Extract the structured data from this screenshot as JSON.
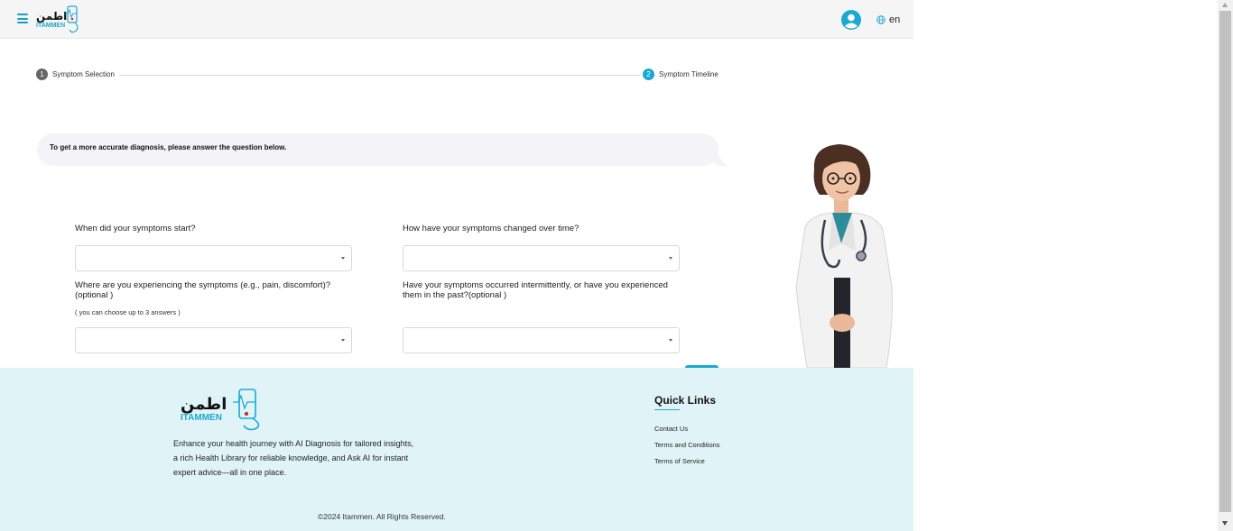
{
  "header": {
    "logo_arabic": "اطمن",
    "logo_text": "ITAMMEN",
    "language": "en",
    "icons": {
      "menu": "hamburger-menu-icon",
      "avatar": "user-avatar-icon",
      "language": "globe-icon"
    }
  },
  "stepper": {
    "steps": [
      {
        "number": "1",
        "label": "Symptom Selection",
        "color": "#666666"
      },
      {
        "number": "2",
        "label": "Symptom Timeline",
        "color": "#1aa9d0"
      }
    ]
  },
  "prompt": {
    "text": "To get a more accurate diagnosis, please answer the question below."
  },
  "questions": [
    {
      "label": "When did your symptoms start?",
      "value": ""
    },
    {
      "label": "How have your symptoms changed over time?",
      "value": ""
    },
    {
      "label": "Where are you experiencing the symptoms (e.g., pain, discomfort)? (optional )",
      "hint": "( you can choose up to 3 answers )",
      "value": ""
    },
    {
      "label": "Have your symptoms occurred intermittently, or have you experienced them in the past?(optional )",
      "value": ""
    }
  ],
  "footer": {
    "logo_arabic": "اطمن",
    "logo_text": "ITAMMEN",
    "description": [
      "Enhance your health journey with AI Diagnosis for tailored insights,",
      "a rich Health Library for reliable knowledge, and Ask AI for instant",
      "expert advice—all in one place."
    ],
    "quick_links_title": "Quick Links",
    "links": [
      "Contact Us",
      "Terms and Conditions",
      "Terms of Service"
    ],
    "copyright": "©2024 Itammen. All Rights Reserved."
  },
  "colors": {
    "accent": "#1aa9d0",
    "footer_bg": "#e0f4f8",
    "header_bg": "#f5f5f5"
  }
}
